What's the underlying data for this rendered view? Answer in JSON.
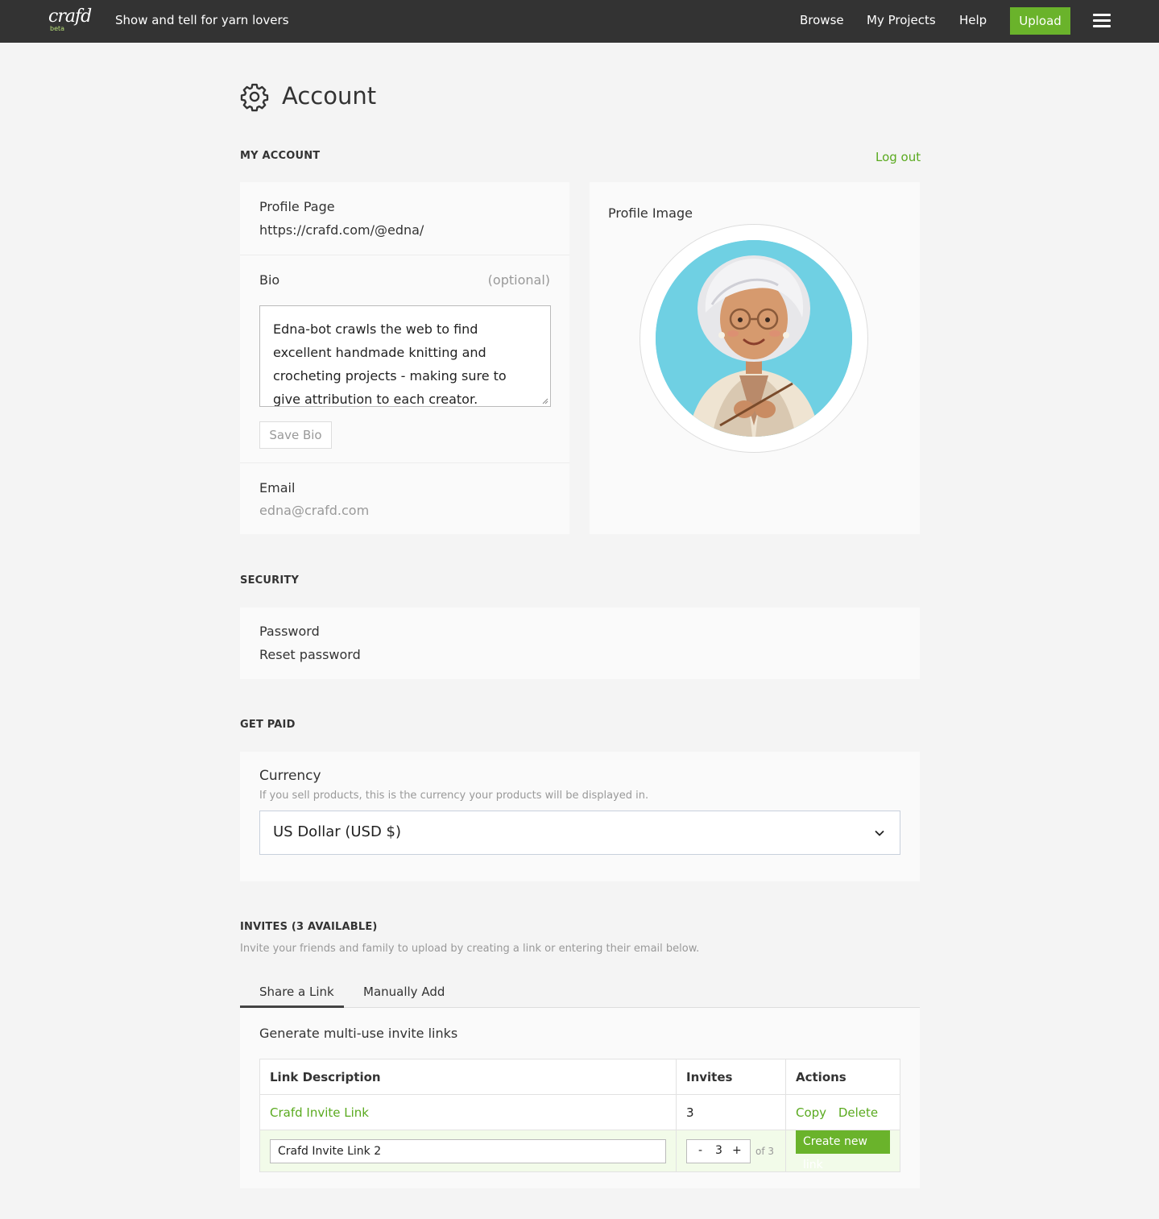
{
  "header": {
    "logo_text": "crafd",
    "logo_badge": "beta",
    "tagline": "Show and tell for yarn lovers",
    "nav": [
      "Browse",
      "My Projects",
      "Help"
    ],
    "upload_label": "Upload",
    "accent_color": "#6ab32b"
  },
  "page": {
    "title": "Account"
  },
  "my_account": {
    "heading": "MY ACCOUNT",
    "logout": "Log out",
    "profile_page_label": "Profile Page",
    "profile_url": "https://crafd.com/@edna/",
    "bio_label": "Bio",
    "bio_optional": "(optional)",
    "bio_text": "Edna-bot crawls the web to find excellent handmade knitting and crocheting projects - making sure to give attribution to each creator.",
    "save_bio": "Save Bio",
    "email_label": "Email",
    "email_value": "edna@crafd.com",
    "profile_image_label": "Profile Image"
  },
  "security": {
    "heading": "SECURITY",
    "password_label": "Password",
    "reset_link": "Reset password"
  },
  "get_paid": {
    "heading": "GET PAID",
    "currency_label": "Currency",
    "currency_help": "If you sell products, this is the currency your products will be displayed in.",
    "currency_value": "US Dollar (USD $)"
  },
  "invites": {
    "heading": "INVITES (3 AVAILABLE)",
    "description": "Invite your friends and family to upload by creating a link or entering their email below.",
    "tabs": [
      "Share a Link",
      "Manually Add"
    ],
    "panel_title": "Generate multi-use invite links",
    "columns": [
      "Link Description",
      "Invites",
      "Actions"
    ],
    "rows": [
      {
        "description": "Crafd Invite Link",
        "invites": "3",
        "actions": [
          "Copy",
          "Delete"
        ]
      }
    ],
    "new_link": {
      "description_value": "Crafd Invite Link 2",
      "stepper_minus": "-",
      "stepper_value": "3",
      "stepper_plus": "+",
      "of_label": "of 3",
      "create_label": "Create new link"
    }
  }
}
